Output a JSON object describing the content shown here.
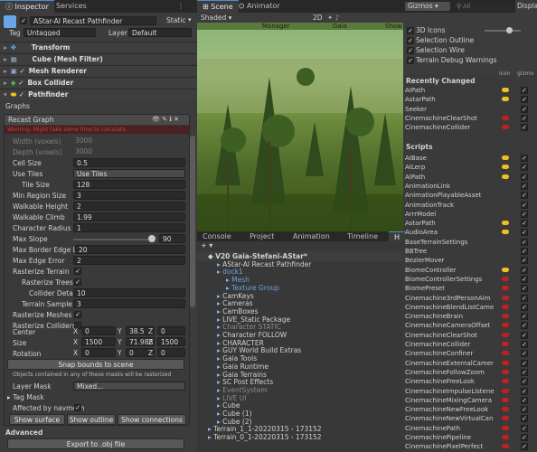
{
  "inspector": {
    "tab": "Inspector",
    "tab2": "Services",
    "object_name": "AStar-AI Recast Pathfinder",
    "static_label": "Static",
    "tag_label": "Tag",
    "tag_value": "Untagged",
    "layer_label": "Layer",
    "layer_value": "Default",
    "components": [
      "Transform",
      "Cube (Mesh Filter)",
      "Mesh Renderer",
      "Box Collider",
      "Pathfinder"
    ],
    "graphs_label": "Graphs",
    "graph_title": "Recast Graph",
    "warning": "Warning: Might take some time to calculate",
    "width_label": "Width (voxels)",
    "width_value": "3000",
    "depth_label": "Depth (voxels)",
    "depth_value": "3000",
    "cell_size_label": "Cell Size",
    "cell_size_value": "0.5",
    "use_tiles_label": "Use Tiles",
    "use_tiles_value": "Use Tiles",
    "tile_size_label": "Tile Size",
    "tile_size_value": "128",
    "min_region_label": "Min Region Size",
    "min_region_value": "3",
    "walk_height_label": "Walkable Height",
    "walk_height_value": "2",
    "walk_climb_label": "Walkable Climb",
    "walk_climb_value": "1.99",
    "char_radius_label": "Character Radius",
    "char_radius_value": "1",
    "max_slope_label": "Max Slope",
    "max_slope_value": "90",
    "max_border_label": "Max Border Edge Len",
    "max_border_value": "20",
    "max_edge_label": "Max Edge Error",
    "max_edge_value": "2",
    "raster_terrain_label": "Rasterize Terrain",
    "raster_trees_label": "Rasterize Trees",
    "collider_detail_label": "Collider Detail",
    "collider_detail_value": "10",
    "terrain_sample_label": "Terrain Sample Si",
    "terrain_sample_value": "3",
    "raster_meshes_label": "Rasterize Meshes",
    "raster_colliders_label": "Rasterize Colliders",
    "center_label": "Center",
    "center_x": "0",
    "center_y": "38.5",
    "center_z": "0",
    "size_label": "Size",
    "size_x": "1500",
    "size_y": "71.98877",
    "size_z": "1500",
    "rotation_label": "Rotation",
    "rot_x": "0",
    "rot_y": "0",
    "rot_z": "0",
    "snap_button": "Snap bounds to scene",
    "mask_info": "Objects contained in any of these masks will be rasterized",
    "layer_mask_label": "Layer Mask",
    "layer_mask_value": "Mixed...",
    "tag_mask_label": "Tag Mask",
    "affected_label": "Affected by navmesh",
    "show_surface": "Show surface",
    "show_outline": "Show outline",
    "show_connections": "Show connections",
    "advanced_label": "Advanced",
    "export_button": "Export to .obj file"
  },
  "scene": {
    "tabs": [
      "Scene",
      "Animator"
    ],
    "shading": "Shaded",
    "mode_2d": "2D",
    "gizmos": "Gizmos",
    "search_placeholder": "All",
    "display": "Displa",
    "overlay_labels": [
      "Manager",
      "Gaia",
      "Show"
    ]
  },
  "gizmos_panel": {
    "options": [
      "3D Icons",
      "Selection Outline",
      "Selection Wire",
      "Terrain Debug Warnings"
    ],
    "recently_changed": "Recently Changed",
    "icon_col": "icon",
    "gizmo_col": "gizmo",
    "recent": [
      "AIPath",
      "AstarPath",
      "Seeker",
      "CinemachineClearShot",
      "CinemachineCollider"
    ],
    "scripts_header": "Scripts",
    "scripts": [
      "AIBase",
      "AILerp",
      "AIPath",
      "AnimationLink",
      "AnimationPlayableAsset",
      "AnimationTrack",
      "ArrrModel",
      "AstarPath",
      "AudioArea",
      "BaseTerrainSettings",
      "BBTree",
      "BezierMover",
      "BiomeController",
      "BiomeControllerSettings",
      "BiomePreset",
      "Cinemachine3rdPersonAim",
      "CinemachineBlendListCame",
      "CinemachineBrain",
      "CinemachineCameraOffset",
      "CinemachineClearShot",
      "CinemachineCollider",
      "CinemachineConfiner",
      "CinemachineExternalCamer",
      "CinemachineFollowZoom",
      "CinemachineFreeLook",
      "CinemachineImpulseListene",
      "CinemachineMixingCamera",
      "CinemachineNewFreeLook",
      "CinemachineNewVirtualCan",
      "CinemachinePath",
      "CinemachinePipeline",
      "CinemachinePixelPerfect"
    ]
  },
  "hierarchy": {
    "tabs": [
      "Console",
      "Project",
      "Animation",
      "Timeline",
      "H"
    ],
    "items": [
      "V20 Gaia-Stefani-AStar*",
      "AStar-AI Recast Pathfinder",
      "dock1",
      "Mesh",
      "Texture Group",
      "CamKeys",
      "Cameras",
      "CamBoxes",
      "LIVE_Static Package",
      "Character STATIC",
      "Character FOLLOW",
      "CHARACTER",
      "GUY World Build Extras",
      "Gaia Tools",
      "Gaia Runtime",
      "Gaia Terrains",
      "SC Post Effects",
      "EventSystem",
      "LIVE UI",
      "Cube",
      "Cube (1)",
      "Cube (2)",
      "Terrain_1_1-20220315 - 173152",
      "Terrain_0_1-20220315 - 173152"
    ]
  }
}
